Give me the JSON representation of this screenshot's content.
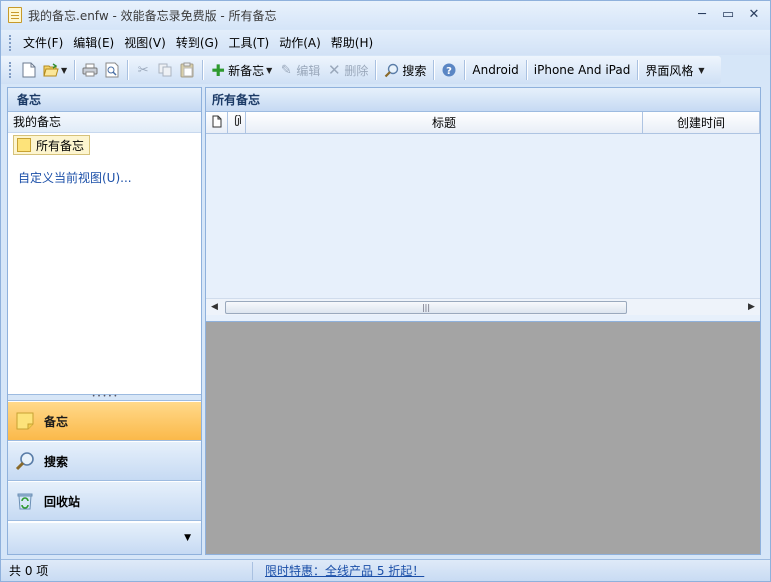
{
  "window": {
    "title": "我的备忘.enfw - 效能备忘录免费版 - 所有备忘",
    "controls": [
      "─",
      "▭",
      "✕"
    ]
  },
  "menu": [
    {
      "label": "文件(F)"
    },
    {
      "label": "编辑(E)"
    },
    {
      "label": "视图(V)"
    },
    {
      "label": "转到(G)"
    },
    {
      "label": "工具(T)"
    },
    {
      "label": "动作(A)"
    },
    {
      "label": "帮助(H)"
    }
  ],
  "toolbar": {
    "new_note": "新备忘",
    "edit": "编辑",
    "delete": "删除",
    "search": "搜索",
    "android": "Android",
    "iphone_ipad": "iPhone And iPad",
    "skin": "界面风格"
  },
  "left_panel": {
    "header": "备忘",
    "group": "我的备忘",
    "folder": "所有备忘",
    "customize": "自定义当前视图(U)...",
    "nav": [
      {
        "label": "备忘",
        "icon": "sticky-note-icon",
        "active": true
      },
      {
        "label": "搜索",
        "icon": "magnifier-icon",
        "active": false
      },
      {
        "label": "回收站",
        "icon": "recycle-bin-icon",
        "active": false
      }
    ]
  },
  "right_panel": {
    "header": "所有备忘",
    "columns": {
      "type_icon": "document-icon",
      "attach_icon": "paperclip-icon",
      "title": "标题",
      "created": "创建时间"
    }
  },
  "status": {
    "count": "共 0 项",
    "promo": "限时特惠：全线产品 5 折起！"
  }
}
